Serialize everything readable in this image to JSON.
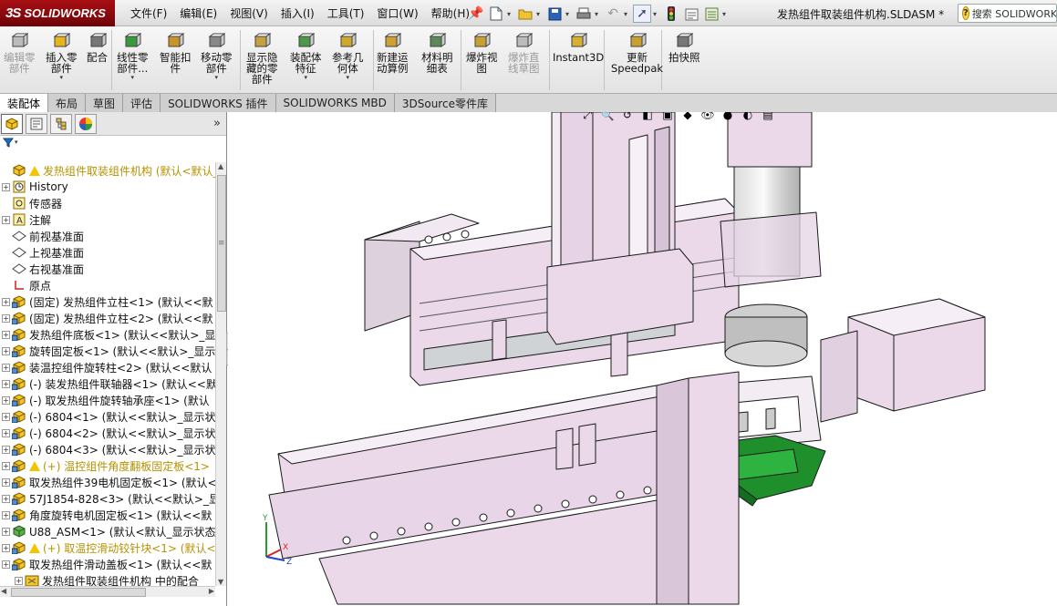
{
  "app": {
    "brand": "SOLIDWORKS",
    "brand_mark": "3S",
    "document_title": "发热组件取装组件机构.SLDASM *",
    "search_placeholder": "搜索 SOLIDWORKS"
  },
  "menus": [
    "文件(F)",
    "编辑(E)",
    "视图(V)",
    "插入(I)",
    "工具(T)",
    "窗口(W)",
    "帮助(H)"
  ],
  "commands": [
    {
      "label": "编辑零\n部件",
      "icon": "edit-component-icon",
      "disabled": true
    },
    {
      "label": "插入零\n部件",
      "icon": "insert-component-icon",
      "dropdown": true
    },
    {
      "label": "配合",
      "icon": "mate-icon"
    },
    {
      "label": "线性零\n部件...",
      "icon": "linear-pattern-icon",
      "dropdown": true
    },
    {
      "label": "智能扣\n件",
      "icon": "smart-fasteners-icon"
    },
    {
      "label": "移动零\n部件",
      "icon": "move-component-icon",
      "dropdown": true
    },
    {
      "label": "显示隐\n藏的零\n部件",
      "icon": "show-hidden-icon"
    },
    {
      "label": "装配体\n特征",
      "icon": "assembly-features-icon",
      "dropdown": true
    },
    {
      "label": "参考几\n何体",
      "icon": "reference-geometry-icon",
      "dropdown": true
    },
    {
      "label": "新建运\n动算例",
      "icon": "new-motion-study-icon"
    },
    {
      "label": "材料明\n细表",
      "icon": "bom-icon"
    },
    {
      "label": "爆炸视\n图",
      "icon": "exploded-view-icon"
    },
    {
      "label": "爆炸直\n线草图",
      "icon": "explode-line-sketch-icon",
      "disabled": true
    },
    {
      "label": "Instant3D",
      "icon": "instant3d-icon"
    },
    {
      "label": "更新\nSpeedpak",
      "icon": "update-speedpak-icon"
    },
    {
      "label": "拍快照",
      "icon": "snapshot-icon"
    }
  ],
  "tabs": [
    "装配体",
    "布局",
    "草图",
    "评估",
    "SOLIDWORKS 插件",
    "SOLIDWORKS MBD",
    "3DSource零件库"
  ],
  "active_tab": 0,
  "panel": {
    "more_label": "»",
    "filter_icon": "filter-icon"
  },
  "tree": [
    {
      "text": "发热组件取装组件机构  (默认<默认_显",
      "icon": "assembly-icon",
      "warn": true,
      "root": true,
      "expander": ""
    },
    {
      "text": "History",
      "icon": "history-icon",
      "expander": "+"
    },
    {
      "text": "传感器",
      "icon": "sensor-icon",
      "expander": ""
    },
    {
      "text": "注解",
      "icon": "annotation-icon",
      "expander": "+"
    },
    {
      "text": "前视基准面",
      "icon": "plane-icon",
      "expander": ""
    },
    {
      "text": "上视基准面",
      "icon": "plane-icon",
      "expander": ""
    },
    {
      "text": "右视基准面",
      "icon": "plane-icon",
      "expander": ""
    },
    {
      "text": "原点",
      "icon": "origin-icon",
      "expander": ""
    },
    {
      "text": "(固定) 发热组件立柱<1> (默认<<默",
      "icon": "part-icon",
      "expander": "+"
    },
    {
      "text": "(固定) 发热组件立柱<2> (默认<<默",
      "icon": "part-icon",
      "expander": "+"
    },
    {
      "text": "发热组件底板<1> (默认<<默认>_显",
      "icon": "part-icon",
      "expander": "+"
    },
    {
      "text": "旋转固定板<1> (默认<<默认>_显示",
      "icon": "part-icon",
      "expander": "+"
    },
    {
      "text": "装温控组件旋转柱<2> (默认<<默认",
      "icon": "part-icon",
      "expander": "+"
    },
    {
      "text": "(-) 装发热组件联轴器<1> (默认<<默",
      "icon": "part-icon",
      "expander": "+"
    },
    {
      "text": "(-) 取发热组件旋转轴承座<1> (默认",
      "icon": "part-icon",
      "expander": "+"
    },
    {
      "text": "(-) 6804<1> (默认<<默认>_显示状",
      "icon": "part-icon",
      "expander": "+"
    },
    {
      "text": "(-) 6804<2> (默认<<默认>_显示状",
      "icon": "part-icon",
      "expander": "+"
    },
    {
      "text": "(-) 6804<3> (默认<<默认>_显示状",
      "icon": "part-icon",
      "expander": "+"
    },
    {
      "text": "(+) 温控组件角度翻板固定板<1>",
      "icon": "part-icon",
      "warn": true,
      "expander": "+"
    },
    {
      "text": "取发热组件39电机固定板<1> (默认<",
      "icon": "part-icon",
      "expander": "+"
    },
    {
      "text": "57J1854-828<3> (默认<<默认>_显",
      "icon": "part-icon",
      "expander": "+"
    },
    {
      "text": "角度旋转电机固定板<1> (默认<<默",
      "icon": "part-icon",
      "expander": "+"
    },
    {
      "text": "U88_ASM<1> (默认<默认_显示状态",
      "icon": "subassembly-icon",
      "expander": "+"
    },
    {
      "text": "(+) 取温控滑动铰针块<1> (默认<",
      "icon": "part-icon",
      "warn": true,
      "expander": "+"
    },
    {
      "text": "取发热组件滑动盖板<1> (默认<<默",
      "icon": "part-icon",
      "expander": "+"
    },
    {
      "text": "发热组件取装组件机构 中的配合",
      "icon": "mates-folder-icon",
      "expander": "+",
      "indent": true
    }
  ],
  "colors": {
    "model_body": "#ebd9ea",
    "model_edge": "#1a1a1a",
    "gripper_green": "#1f8f2c",
    "brand_red": "#9a0b10",
    "tree_warning_text": "#b59200"
  }
}
